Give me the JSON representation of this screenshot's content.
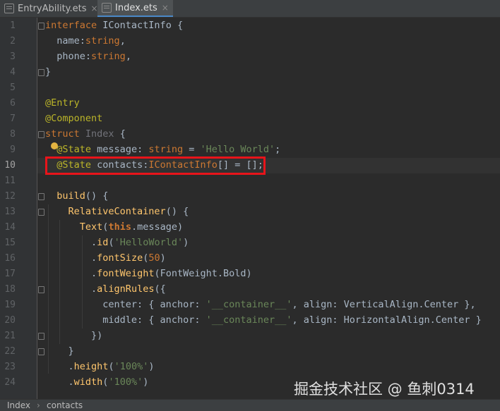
{
  "tabs": [
    {
      "label": "EntryAbility.ets",
      "close": "×",
      "active": false
    },
    {
      "label": "Index.ets",
      "close": "×",
      "active": true
    }
  ],
  "line_numbers": [
    "1",
    "2",
    "3",
    "4",
    "5",
    "6",
    "7",
    "8",
    "9",
    "10",
    "11",
    "12",
    "13",
    "14",
    "15",
    "16",
    "17",
    "18",
    "19",
    "20",
    "21",
    "22",
    "23",
    "24"
  ],
  "code": {
    "l1": {
      "kw": "interface",
      "rest": " IContactInfo {"
    },
    "l2": {
      "name": "name",
      "colon": ":",
      "type": "string",
      "tail": ","
    },
    "l3": {
      "name": "phone",
      "colon": ":",
      "type": "string",
      "tail": ","
    },
    "l4": "}",
    "l6": "@Entry",
    "l7": "@Component",
    "l8": {
      "kw": "struct",
      "name": " Index",
      "tail": " {"
    },
    "l9": {
      "ann": "@State",
      "rest": " message: ",
      "type": "string",
      "eq": " = ",
      "str": "'Hello World'",
      "tail": ";"
    },
    "l10": {
      "ann": "@State",
      "rest": " contacts:",
      "type": "IContactInfo",
      "tail": "[] = [];"
    },
    "l12": {
      "fn": "build",
      "tail": "() {"
    },
    "l13": {
      "fn": "RelativeContainer",
      "tail": "() {"
    },
    "l14": {
      "fn": "Text",
      "open": "(",
      "kw": "this",
      "tail": ".message)"
    },
    "l15": {
      "dot": ".",
      "fn": "id",
      "open": "(",
      "str": "'HelloWorld'",
      "tail": ")"
    },
    "l16": {
      "dot": ".",
      "fn": "fontSize",
      "open": "(",
      "num": "50",
      "tail": ")"
    },
    "l17": {
      "dot": ".",
      "fn": "fontWeight",
      "tail": "(FontWeight.Bold)"
    },
    "l18": {
      "dot": ".",
      "fn": "alignRules",
      "tail": "({"
    },
    "l19": {
      "a": "center: { anchor: ",
      "str": "'__container__'",
      "b": ", align: VerticalAlign.Center },"
    },
    "l20": {
      "a": "middle: { anchor: ",
      "str": "'__container__'",
      "b": ", align: HorizontalAlign.Center }"
    },
    "l21": "})",
    "l22": "}",
    "l23": {
      "dot": ".",
      "fn": "height",
      "open": "(",
      "str": "'100%'",
      "tail": ")"
    },
    "l24": {
      "dot": ".",
      "fn": "width",
      "open": "(",
      "str": "'100%'",
      "tail": ")"
    }
  },
  "statusbar": {
    "crumb1": "Index",
    "crumb2": "contacts"
  },
  "watermark": "掘金技术社区 @ 鱼刺0314",
  "colors": {
    "highlight_box": "#e8141a",
    "keyword": "#cc7832",
    "string": "#6a8759",
    "annotation": "#bbb529",
    "function": "#ffc66d"
  }
}
